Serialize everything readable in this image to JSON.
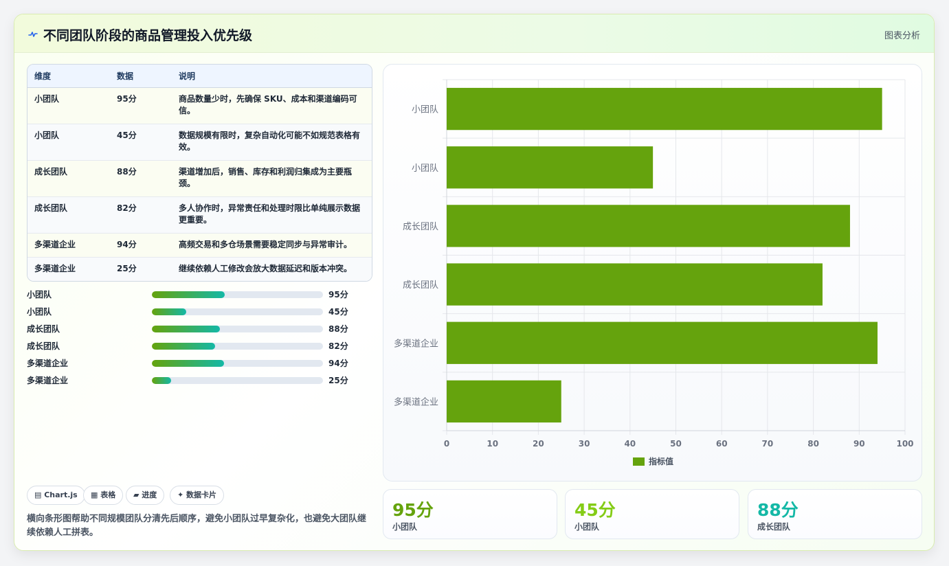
{
  "header": {
    "title": "不同团队阶段的商品管理投入优先级",
    "tag": "图表分析"
  },
  "table": {
    "columns": [
      "维度",
      "数据",
      "说明"
    ],
    "rows": [
      {
        "dim": "小团队",
        "data": "95分",
        "desc": "商品数量少时，先确保 SKU、成本和渠道编码可信。"
      },
      {
        "dim": "小团队",
        "data": "45分",
        "desc": "数据规模有限时，复杂自动化可能不如规范表格有效。"
      },
      {
        "dim": "成长团队",
        "data": "88分",
        "desc": "渠道增加后，销售、库存和利润归集成为主要瓶颈。"
      },
      {
        "dim": "成长团队",
        "data": "82分",
        "desc": "多人协作时，异常责任和处理时限比单纯展示数据更重要。"
      },
      {
        "dim": "多渠道企业",
        "data": "94分",
        "desc": "高频交易和多仓场景需要稳定同步与异常审计。"
      },
      {
        "dim": "多渠道企业",
        "data": "25分",
        "desc": "继续依赖人工修改会放大数据延迟和版本冲突。"
      }
    ]
  },
  "progress": [
    {
      "label": "小团队",
      "value": 95,
      "text": "95分"
    },
    {
      "label": "小团队",
      "value": 45,
      "text": "45分"
    },
    {
      "label": "成长团队",
      "value": 88,
      "text": "88分"
    },
    {
      "label": "成长团队",
      "value": 82,
      "text": "82分"
    },
    {
      "label": "多渠道企业",
      "value": 94,
      "text": "94分"
    },
    {
      "label": "多渠道企业",
      "value": 25,
      "text": "25分"
    }
  ],
  "chips": [
    "▤ Chart.js",
    "▦ 表格",
    "▰ 进度",
    "✦ 数据卡片"
  ],
  "note": "横向条形图帮助不同规模团队分清先后顺序，避免小团队过早复杂化，也避免大团队继续依赖人工拼表。",
  "chart_data": {
    "type": "bar",
    "orientation": "horizontal",
    "categories": [
      "小团队",
      "小团队",
      "成长团队",
      "成长团队",
      "多渠道企业",
      "多渠道企业"
    ],
    "series": [
      {
        "name": "指标值",
        "values": [
          95,
          45,
          88,
          82,
          94,
          25
        ],
        "color": "#65a30d"
      }
    ],
    "xlim": [
      0,
      100
    ],
    "xticks": [
      0,
      10,
      20,
      30,
      40,
      50,
      60,
      70,
      80,
      90,
      100
    ],
    "grid": true,
    "legend": "bottom"
  },
  "stats": [
    {
      "value": "95分",
      "label": "小团队",
      "color": "#65a30d"
    },
    {
      "value": "45分",
      "label": "小团队",
      "color": "#84cc16"
    },
    {
      "value": "88分",
      "label": "成长团队",
      "color": "#14b8a6"
    }
  ]
}
